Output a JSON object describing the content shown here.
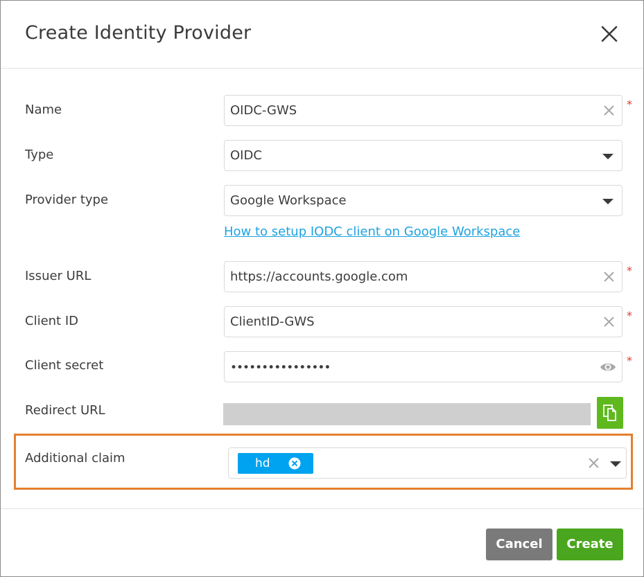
{
  "dialog": {
    "title": "Create Identity Provider",
    "close_icon": "close-icon"
  },
  "form": {
    "name": {
      "label": "Name",
      "value": "OIDC-GWS",
      "required": "*"
    },
    "type": {
      "label": "Type",
      "value": "OIDC"
    },
    "provider_type": {
      "label": "Provider type",
      "value": "Google Workspace"
    },
    "help_link": "How to setup IODC client on Google Workspace",
    "issuer_url": {
      "label": "Issuer URL",
      "value": "https://accounts.google.com",
      "required": "*"
    },
    "client_id": {
      "label": "Client ID",
      "value": "ClientID-GWS",
      "required": "*"
    },
    "client_secret": {
      "label": "Client secret",
      "value": "••••••••••••••••",
      "required": "*"
    },
    "redirect_url": {
      "label": "Redirect URL",
      "copy_icon": "copy-icon"
    },
    "additional_claim": {
      "label": "Additional claim",
      "chips": [
        "hd"
      ]
    }
  },
  "footer": {
    "cancel_label": "Cancel",
    "create_label": "Create"
  },
  "colors": {
    "accent_link": "#1fa3e0",
    "chip": "#00a3f0",
    "create_button": "#4aa61e",
    "cancel_button": "#7a7a7a",
    "copy_button": "#5fb91e",
    "highlight": "#e57f2e",
    "required": "#e53935"
  }
}
